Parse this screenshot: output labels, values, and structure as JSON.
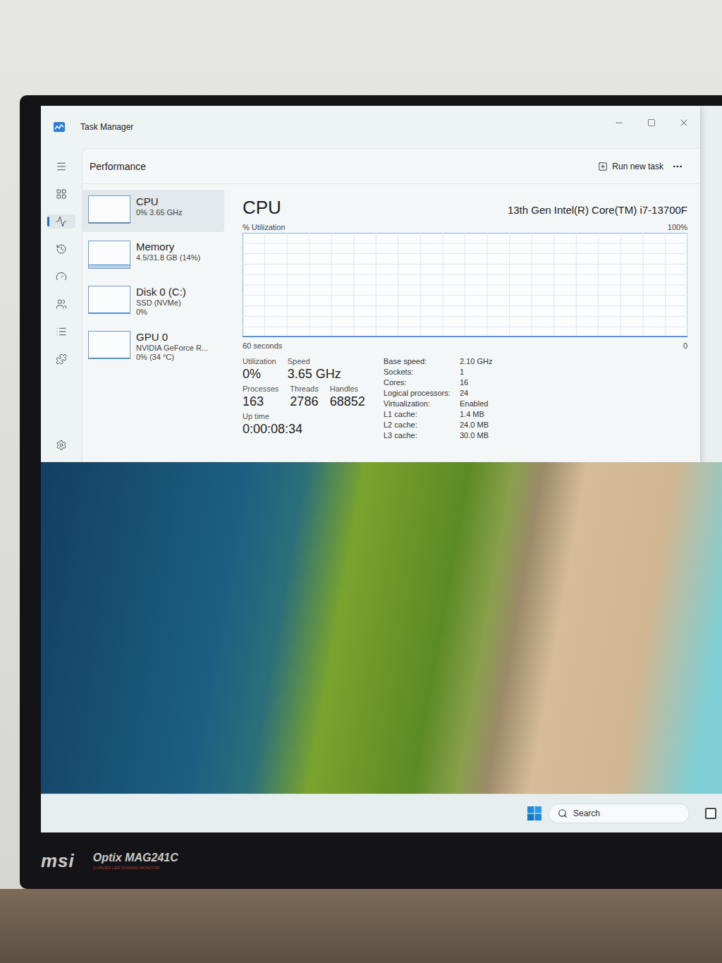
{
  "window": {
    "title": "Task Manager"
  },
  "header": {
    "title": "Performance",
    "run_task": "Run new task"
  },
  "rail": [
    {
      "selected": false
    },
    {
      "selected": false
    },
    {
      "selected": true
    },
    {
      "selected": false
    },
    {
      "selected": false
    },
    {
      "selected": false
    },
    {
      "selected": false
    },
    {
      "selected": false
    }
  ],
  "devices": [
    {
      "name": "CPU",
      "lines": [
        "0% 3.65 GHz"
      ],
      "level": 0,
      "selected": true
    },
    {
      "name": "Memory",
      "lines": [
        "4.5/31.8 GB (14%)"
      ],
      "level": 0.14,
      "selected": false
    },
    {
      "name": "Disk 0 (C:)",
      "lines": [
        "SSD (NVMe)",
        "0%"
      ],
      "level": 0,
      "selected": false
    },
    {
      "name": "GPU 0",
      "lines": [
        "NVIDIA GeForce R...",
        "0% (34 °C)"
      ],
      "level": 0,
      "selected": false
    }
  ],
  "cpu": {
    "title": "CPU",
    "model": "13th Gen Intel(R) Core(TM) i7-13700F",
    "axis_label": "% Utilization",
    "axis_max": "100%",
    "time_span": "60 seconds",
    "axis_min": "0",
    "values": [
      0,
      0,
      0,
      0,
      0,
      0,
      0,
      0,
      0,
      0,
      0,
      0,
      0,
      0,
      0,
      0,
      0,
      0,
      0,
      0
    ]
  },
  "stat_rows": [
    [
      {
        "label": "Utilization",
        "value": "0%"
      },
      {
        "label": "Speed",
        "value": "3.65 GHz"
      }
    ],
    [
      {
        "label": "Processes",
        "value": "163"
      },
      {
        "label": "Threads",
        "value": "2786"
      },
      {
        "label": "Handles",
        "value": "68852"
      }
    ],
    [
      {
        "label": "Up time",
        "value": "0:00:08:34"
      }
    ]
  ],
  "specs": [
    {
      "label": "Base speed:",
      "value": "2.10 GHz"
    },
    {
      "label": "Sockets:",
      "value": "1"
    },
    {
      "label": "Cores:",
      "value": "16"
    },
    {
      "label": "Logical processors:",
      "value": "24"
    },
    {
      "label": "Virtualization:",
      "value": "Enabled"
    },
    {
      "label": "L1 cache:",
      "value": "1.4 MB"
    },
    {
      "label": "L2 cache:",
      "value": "24.0 MB"
    },
    {
      "label": "L3 cache:",
      "value": "30.0 MB"
    }
  ],
  "taskbar": {
    "search": "Search"
  },
  "monitor": {
    "brand": "msi",
    "model": "Optix MAG241C",
    "tagline": "CURVED LED GAMING MONITOR"
  }
}
